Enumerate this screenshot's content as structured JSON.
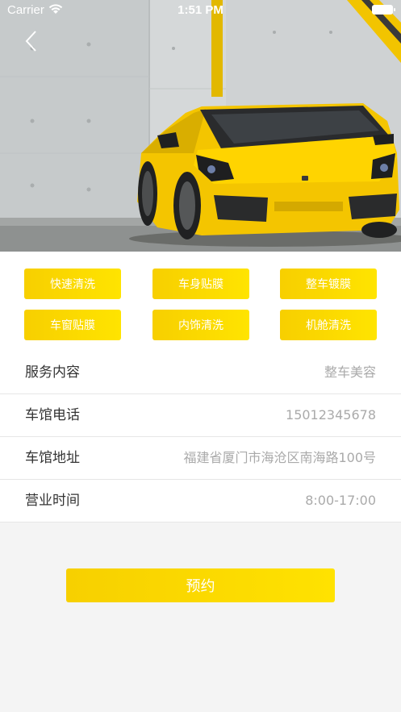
{
  "status_bar": {
    "carrier": "Carrier",
    "time": "1:51 PM"
  },
  "hero": {
    "image_subject": "yellow sports car",
    "accent_color": "#f5c800"
  },
  "service_tags": [
    {
      "label": "快速清洗"
    },
    {
      "label": "车身贴膜"
    },
    {
      "label": "整车镀膜"
    },
    {
      "label": "车窗贴膜"
    },
    {
      "label": "内饰清洗"
    },
    {
      "label": "机舱清洗"
    }
  ],
  "info_rows": [
    {
      "label": "服务内容",
      "value": "整车美容"
    },
    {
      "label": "车馆电话",
      "value": "15012345678"
    },
    {
      "label": "车馆地址",
      "value": "福建省厦门市海沧区南海路100号"
    },
    {
      "label": "营业时间",
      "value": "8:00-17:00"
    }
  ],
  "book_button": {
    "label": "预约"
  },
  "colors": {
    "brand_yellow": "#ffd800",
    "label_text": "#333333",
    "value_text": "#aaaaaa",
    "page_bg": "#f4f4f4"
  }
}
